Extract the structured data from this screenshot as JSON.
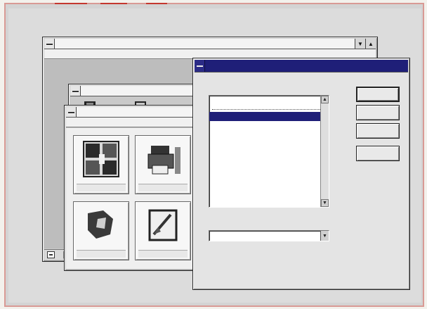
{
  "main_window": {
    "title": "",
    "menu": [
      "",
      "",
      ""
    ],
    "status_text": ""
  },
  "sub_window": {
    "title": ""
  },
  "child_window": {
    "title": "",
    "menu": [
      "",
      "",
      "",
      ""
    ],
    "tiles": [
      {
        "label": "",
        "icon": "grid-icon"
      },
      {
        "label": "",
        "icon": "printer-icon"
      },
      {
        "label": "",
        "icon": "shape-icon"
      },
      {
        "label": "",
        "icon": "drawing-icon"
      }
    ]
  },
  "dialog": {
    "title": "",
    "list_label": "",
    "list_items": [
      {
        "text": "",
        "selected": false
      },
      {
        "text": "",
        "selected": true
      }
    ],
    "field_label": "",
    "field_value": "",
    "footer_label": "",
    "buttons": [
      "",
      "",
      "",
      ""
    ]
  },
  "colors": {
    "active_title": "#1f1f78",
    "selection": "#1f1f78",
    "border_accent": "#c4372f"
  }
}
